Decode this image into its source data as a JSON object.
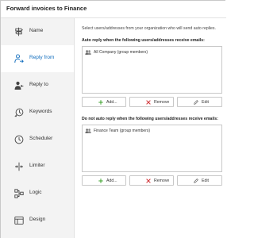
{
  "window": {
    "title": "Forward invoices to Finance"
  },
  "sidebar": {
    "items": [
      {
        "label": "Name",
        "icon": "signpost-icon",
        "active": false
      },
      {
        "label": "Reply from",
        "icon": "person-arrow-icon",
        "active": true
      },
      {
        "label": "Reply to",
        "icon": "person-reply-icon",
        "active": false
      },
      {
        "label": "Keywords",
        "icon": "key-icon",
        "active": false
      },
      {
        "label": "Scheduler",
        "icon": "clock-icon",
        "active": false
      },
      {
        "label": "Limiter",
        "icon": "limiter-icon",
        "active": false
      },
      {
        "label": "Logic",
        "icon": "logic-icon",
        "active": false
      },
      {
        "label": "Design",
        "icon": "design-icon",
        "active": false
      }
    ],
    "active_color": "#0f6cbd"
  },
  "main": {
    "intro": "Select users/addresses from your organization who will send auto replies.",
    "sections": [
      {
        "label": "Auto reply when the following users/addresses receive emails:",
        "entries": [
          "All Company (group members)"
        ],
        "buttons": {
          "add": "Add...",
          "remove": "Remove",
          "edit": "Edit"
        }
      },
      {
        "label": "Do not auto reply when the following users/addresses receive emails:",
        "entries": [
          "Finance Team (group members)"
        ],
        "buttons": {
          "add": "Add...",
          "remove": "Remove",
          "edit": "Edit"
        }
      }
    ]
  },
  "colors": {
    "add_green": "#3aa02a",
    "remove_red": "#d13438",
    "accent_blue": "#0f6cbd"
  }
}
